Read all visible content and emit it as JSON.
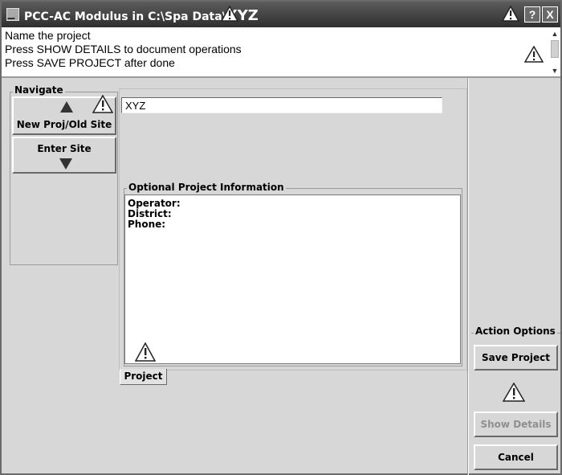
{
  "window": {
    "title_prefix": "PCC-AC Modulus in C:\\Spa Data\\",
    "title_project": "XYZ",
    "help_button": "?",
    "close_button": "X"
  },
  "messages": [
    "Name the project",
    "Press SHOW DETAILS to document operations",
    "Press SAVE PROJECT after done"
  ],
  "navigate": {
    "label": "Navigate",
    "new_proj_button": "New Proj/Old Site",
    "enter_site_button": "Enter Site"
  },
  "project": {
    "name_value": "XYZ",
    "optional_label": "Optional Project Information",
    "optional_lines": [
      "Operator:",
      "District:",
      "Phone:"
    ],
    "tab_label": "Project"
  },
  "actions": {
    "label": "Action Options",
    "save_button": "Save Project",
    "show_details_button": "Show Details",
    "cancel_button": "Cancel"
  },
  "icons": {
    "app": "app-icon",
    "warning": "warning-triangle-icon",
    "arrow_up": "arrow-up-icon",
    "arrow_down": "arrow-down-icon"
  }
}
